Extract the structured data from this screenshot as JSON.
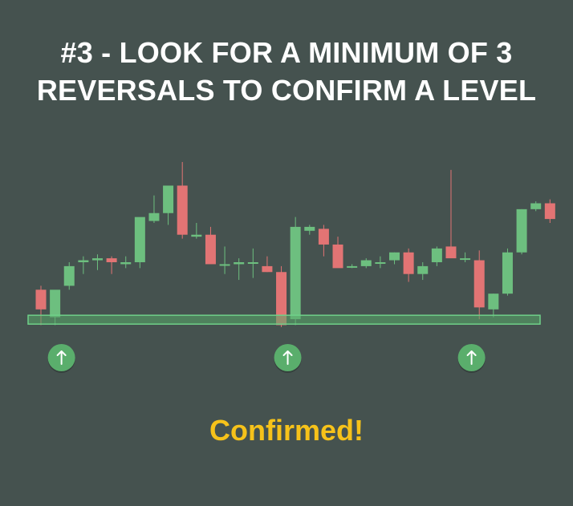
{
  "title": {
    "line1": "#3 -  LOOK FOR A MINIMUM OF 3",
    "line2": "REVERSALS TO CONFIRM A LEVEL"
  },
  "caption": "Confirmed!",
  "colors": {
    "background": "#45524f",
    "bullish": "#6dbf7f",
    "bearish": "#e27474",
    "zone_fill": "#58a86a",
    "zone_border": "#6fd089",
    "marker": "#5aae6c",
    "caption": "#f6c21a"
  },
  "chart_data": {
    "type": "candlestick",
    "xlabel": "",
    "ylabel": "",
    "grid": false,
    "ylim": [
      0,
      100
    ],
    "support_zone": {
      "low": 8.5,
      "high": 13
    },
    "reversal_markers": [
      {
        "candle_index": 1,
        "icon": "arrow-up-icon"
      },
      {
        "candle_index": 17,
        "icon": "arrow-up-icon"
      },
      {
        "candle_index": 30,
        "icon": "arrow-up-icon"
      }
    ],
    "candles": [
      {
        "o": 26,
        "h": 28,
        "l": 8,
        "c": 16
      },
      {
        "o": 12,
        "h": 24,
        "l": 8,
        "c": 26
      },
      {
        "o": 28,
        "h": 40,
        "l": 26,
        "c": 38
      },
      {
        "o": 40,
        "h": 43,
        "l": 34,
        "c": 41
      },
      {
        "o": 41,
        "h": 44,
        "l": 36,
        "c": 42
      },
      {
        "o": 42,
        "h": 43,
        "l": 34,
        "c": 40
      },
      {
        "o": 39,
        "h": 43,
        "l": 37,
        "c": 40
      },
      {
        "o": 40,
        "h": 58,
        "l": 37,
        "c": 63
      },
      {
        "o": 61,
        "h": 74,
        "l": 60,
        "c": 65
      },
      {
        "o": 65,
        "h": 75,
        "l": 59,
        "c": 79
      },
      {
        "o": 79,
        "h": 91,
        "l": 52,
        "c": 54
      },
      {
        "o": 53,
        "h": 60,
        "l": 52,
        "c": 54
      },
      {
        "o": 54,
        "h": 58,
        "l": 40,
        "c": 39
      },
      {
        "o": 39,
        "h": 48,
        "l": 34,
        "c": 39
      },
      {
        "o": 39,
        "h": 42,
        "l": 31,
        "c": 40
      },
      {
        "o": 40,
        "h": 47,
        "l": 32,
        "c": 40
      },
      {
        "o": 38,
        "h": 43,
        "l": 35,
        "c": 35
      },
      {
        "o": 35,
        "h": 38,
        "l": 7,
        "c": 8
      },
      {
        "o": 11,
        "h": 63,
        "l": 8,
        "c": 58
      },
      {
        "o": 56,
        "h": 59,
        "l": 54,
        "c": 58
      },
      {
        "o": 57,
        "h": 59,
        "l": 43,
        "c": 49
      },
      {
        "o": 49,
        "h": 53,
        "l": 38,
        "c": 37
      },
      {
        "o": 38,
        "h": 39,
        "l": 37,
        "c": 38
      },
      {
        "o": 38,
        "h": 42,
        "l": 37,
        "c": 41
      },
      {
        "o": 40,
        "h": 43,
        "l": 37,
        "c": 40
      },
      {
        "o": 41,
        "h": 45,
        "l": 39,
        "c": 45
      },
      {
        "o": 45,
        "h": 47,
        "l": 30,
        "c": 34
      },
      {
        "o": 34,
        "h": 40,
        "l": 31,
        "c": 38
      },
      {
        "o": 40,
        "h": 48,
        "l": 38,
        "c": 47
      },
      {
        "o": 48,
        "h": 87,
        "l": 45,
        "c": 42
      },
      {
        "o": 42,
        "h": 45,
        "l": 40,
        "c": 42
      },
      {
        "o": 41,
        "h": 46,
        "l": 11,
        "c": 17
      },
      {
        "o": 16,
        "h": 24,
        "l": 12,
        "c": 24
      },
      {
        "o": 24,
        "h": 47,
        "l": 23,
        "c": 45
      },
      {
        "o": 45,
        "h": 67,
        "l": 44,
        "c": 67
      },
      {
        "o": 67,
        "h": 71,
        "l": 66,
        "c": 70
      },
      {
        "o": 70,
        "h": 72,
        "l": 60,
        "c": 62
      }
    ]
  }
}
